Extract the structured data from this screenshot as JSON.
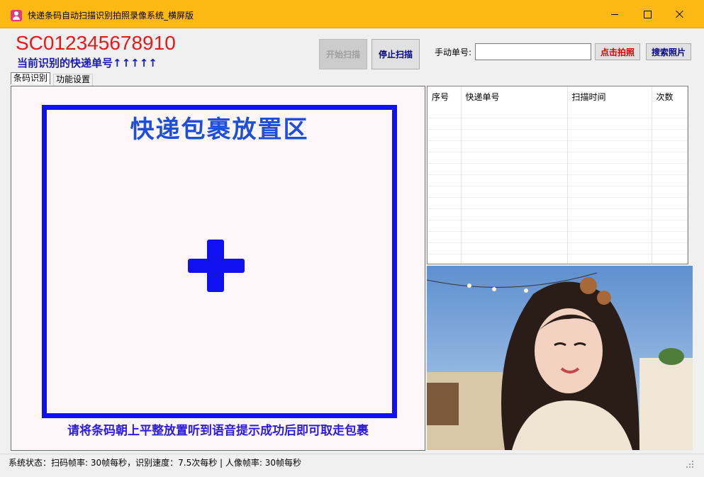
{
  "window": {
    "title": "快递条码自动扫描识别拍照录像系统_横屏版",
    "title_bar_color": "#fdb913",
    "icon": "user-app-icon"
  },
  "header": {
    "current_code": "SC012345678910",
    "code_hint": "当前识别的快递单号↑↑↑↑↑",
    "start_button": "开始扫描",
    "stop_button": "停止扫描",
    "manual_label": "手动单号:",
    "manual_value": "",
    "shoot_button": "点击拍照",
    "search_button": "搜索照片"
  },
  "tabs": [
    {
      "label": "条码识别",
      "active": true
    },
    {
      "label": "功能设置",
      "active": false
    }
  ],
  "camera_zone": {
    "title": "快递包裹放置区",
    "instruction": "请将条码朝上平整放置听到语音提示成功后即可取走包裹",
    "frame_color": "#1010f0"
  },
  "table": {
    "columns": [
      "序号",
      "快递单号",
      "扫描时间",
      "次数"
    ],
    "rows": []
  },
  "photo": {
    "icon": "portrait-photo"
  },
  "status": {
    "text": "系统状态：扫码帧率: 30帧每秒，识别速度：7.5次每秒 |    人像帧率: 30帧每秒"
  }
}
